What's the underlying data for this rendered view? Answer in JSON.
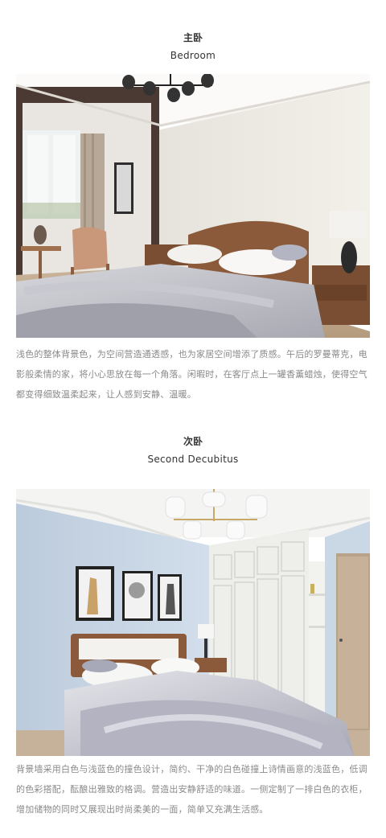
{
  "section1": {
    "title_cn": "主卧",
    "title_en": "Bedroom",
    "paragraph": "浅色的整体背景色，为空间营造通透感，也为家居空间增添了质感。午后的罗曼蒂克，电影般柔情的家，将小心思放在每一个角落。闲暇时，在客厅点上一罐香薰蜡烛，使得空气都变得细致温柔起来，让人感到安静、温暖。"
  },
  "section2": {
    "title_cn": "次卧",
    "title_en": "Second Decubitus",
    "paragraph": "背景墙采用白色与浅蓝色的撞色设计，简约、干净的白色碰撞上诗情画意的浅蓝色，低调的色彩搭配，酝酿出雅致的格调。营造出安静舒适的味道。一侧定制了一排白色的衣柜，增加储物的同时又展现出时尚柔美的一面，简单又充满生活感。"
  },
  "colors": {
    "wall_cream": "#eeeae3",
    "wall_blue": "#c7d6e6",
    "bedding_grey": "#b9b9c2",
    "wood": "#8a5a3a"
  }
}
